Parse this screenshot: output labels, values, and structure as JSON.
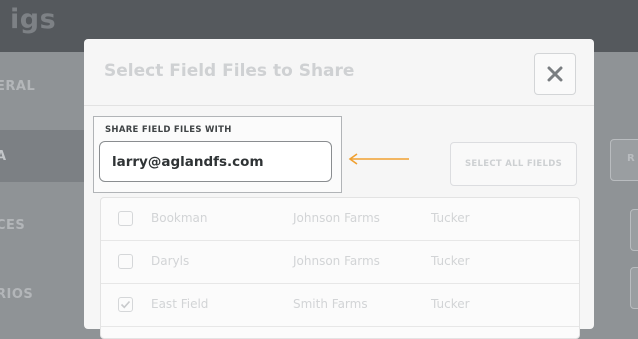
{
  "background": {
    "title": "igs",
    "sidebar_items": [
      {
        "label": "ERAL"
      },
      {
        "label": "A"
      },
      {
        "label": "CES"
      },
      {
        "label": "RIOS"
      }
    ],
    "right_text": "R"
  },
  "modal": {
    "title": "Select Field Files to Share",
    "close_icon": "close-x-icon",
    "share": {
      "label": "SHARE FIELD FILES WITH",
      "value": "larry@aglandfs.com"
    },
    "select_all_label": "SELECT ALL FIELDS",
    "fields": [
      {
        "name": "Bookman",
        "farm": "Johnson Farms",
        "owner": "Tucker",
        "checked": false
      },
      {
        "name": "Daryls",
        "farm": "Johnson Farms",
        "owner": "Tucker",
        "checked": false
      },
      {
        "name": "East Field",
        "farm": "Smith Farms",
        "owner": "Tucker",
        "checked": true
      }
    ]
  },
  "colors": {
    "annotation_arrow": "#f0a030",
    "overlay": "#8f9396"
  }
}
